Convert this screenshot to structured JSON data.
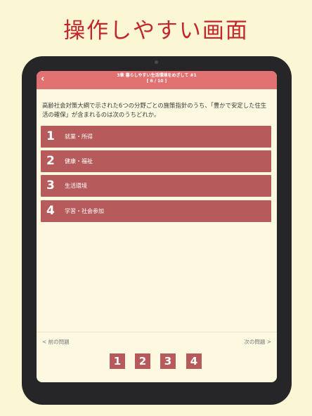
{
  "headline": "操作しやすい画面",
  "appbar": {
    "back_icon": "‹",
    "title": "3章 暮らしやすい生活環境をめざして #1",
    "progress": "[ 6 / 10 ]"
  },
  "question": "高齢社会対策大綱で示された6つの分野ごとの施策指針のうち、「豊かで安定した住生活の確保」が含まれるのは次のうちどれか。",
  "choices": [
    {
      "num": "1",
      "label": "就業・所得"
    },
    {
      "num": "2",
      "label": "健康・福祉"
    },
    {
      "num": "3",
      "label": "生活環境"
    },
    {
      "num": "4",
      "label": "学習・社会参加"
    }
  ],
  "nav": {
    "prev": "< 前の問題",
    "next": "次の問題 >"
  },
  "answer_buttons": [
    "1",
    "2",
    "3",
    "4"
  ],
  "colors": {
    "background": "#fbf6d3",
    "headline": "#c1272d",
    "appbar": "#e27271",
    "choice": "#b65a5b"
  }
}
